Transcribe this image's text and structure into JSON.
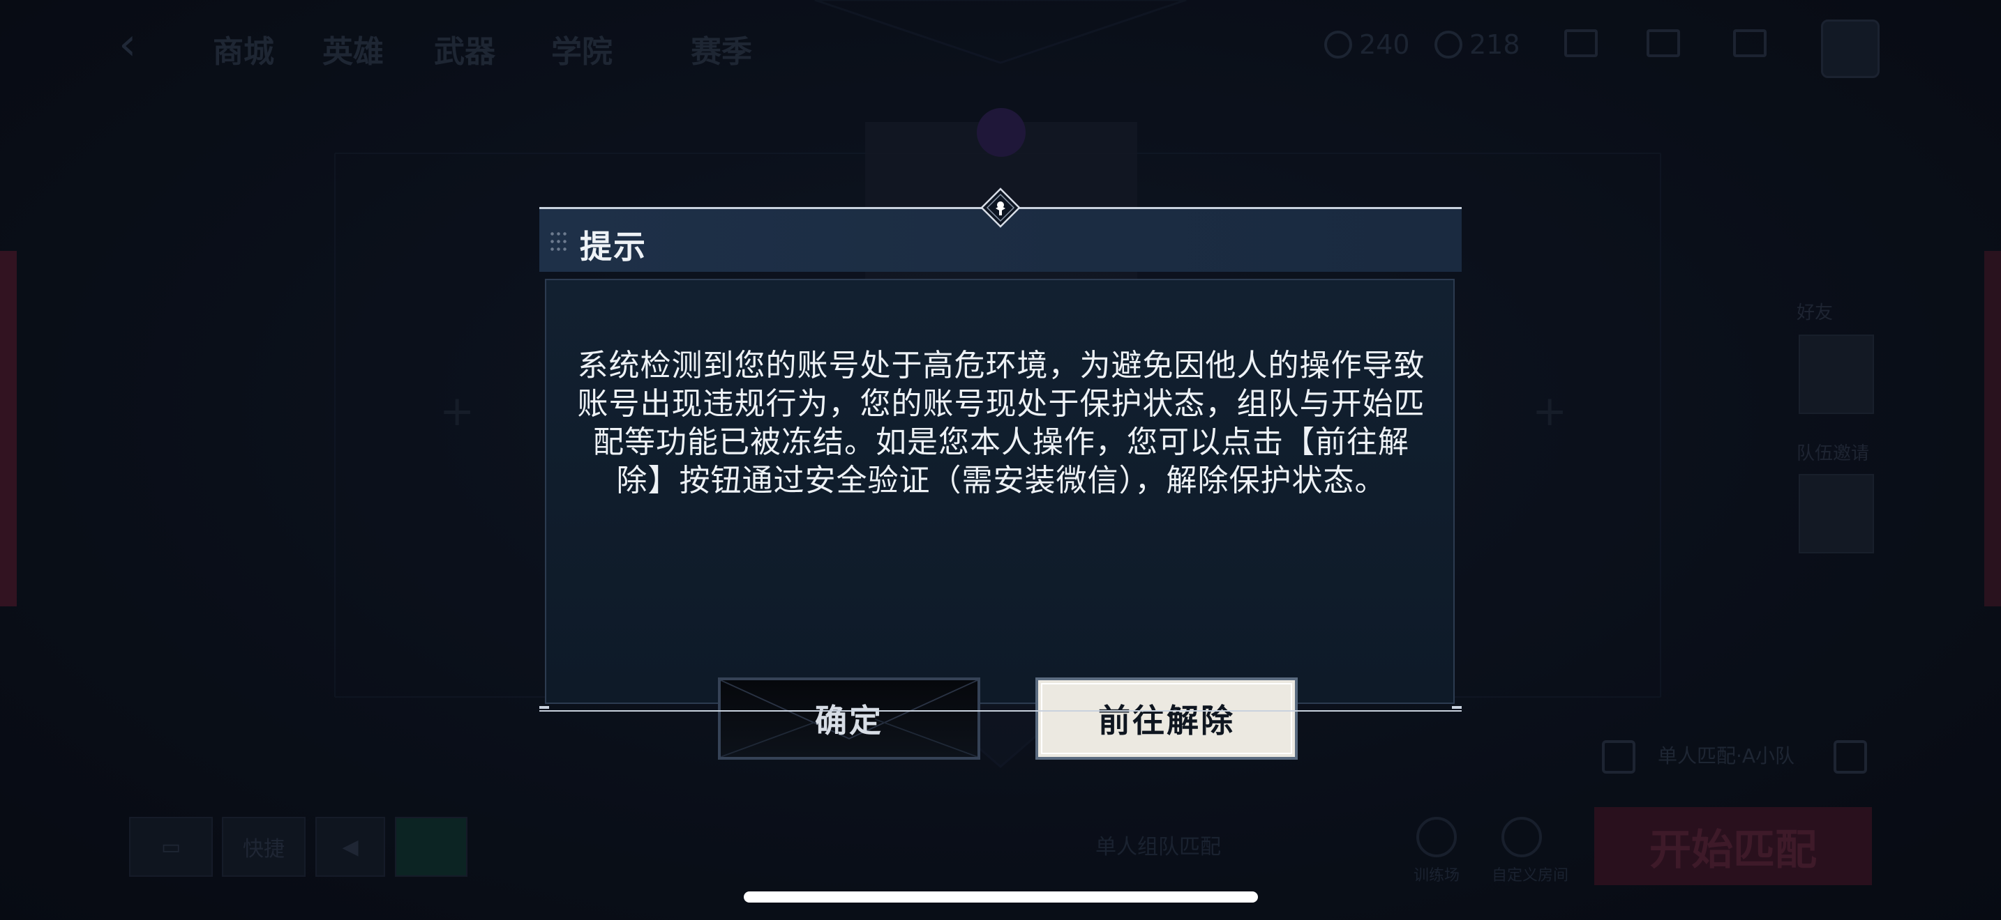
{
  "background": {
    "nav_items": [
      "商城",
      "英雄",
      "武器",
      "学院",
      "赛季"
    ],
    "resource_1": "240",
    "resource_2": "218",
    "right_label_1": "好友",
    "right_label_2": "队伍邀请",
    "bottom_btn_2": "快捷",
    "bottom_mid_text": "单人组队匹配",
    "bottom_icon_1_label": "训练场",
    "bottom_icon_2_label": "自定义房间",
    "team_text": "单人匹配·A小队",
    "start_button": "开始匹配"
  },
  "dialog": {
    "title": "提示",
    "message": "系统检测到您的账号处于高危环境，为避免因他人的操作导致账号出现违规行为，您的账号现处于保护状态，组队与开始匹配等功能已被冻结。如是您本人操作，您可以点击【前往解除】按钮通过安全验证（需安装微信），解除保护状态。",
    "confirm_label": "确定",
    "unlock_label": "前往解除"
  },
  "colors": {
    "accent_red": "#3c1426",
    "dialog_header": "#1e3048",
    "primary_button": "#ece9e1"
  }
}
